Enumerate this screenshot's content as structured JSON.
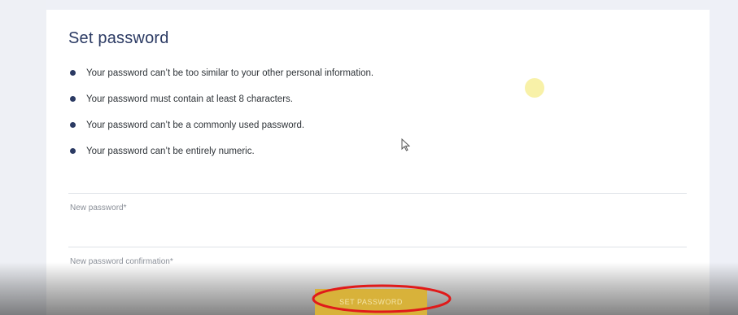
{
  "page": {
    "title": "Set password"
  },
  "rules": [
    "Your password can’t be too similar to your other personal information.",
    "Your password must contain at least 8 characters.",
    "Your password can’t be a commonly used password.",
    "Your password can’t be entirely numeric."
  ],
  "form": {
    "new_password_label": "New password*",
    "confirm_password_label": "New password confirmation*",
    "submit_label": "SET PASSWORD"
  },
  "colors": {
    "accent": "#2b3a63",
    "button": "#d8b23a",
    "annotation": "#e01a1a",
    "highlight": "#f7ef9e"
  },
  "icons": {
    "cursor": "mouse-pointer-icon",
    "bullet": "bullet-dot-icon"
  }
}
